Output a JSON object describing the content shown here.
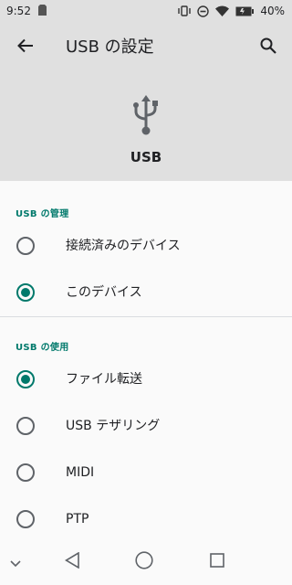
{
  "status": {
    "time": "9:52",
    "battery": "40%"
  },
  "toolbar": {
    "title": "USB の設定"
  },
  "hero": {
    "label": "USB"
  },
  "sections": {
    "management": {
      "header": "USB の管理",
      "options": [
        {
          "label": "接続済みのデバイス",
          "checked": false
        },
        {
          "label": "このデバイス",
          "checked": true
        }
      ]
    },
    "usage": {
      "header": "USB の使用",
      "options": [
        {
          "label": "ファイル転送",
          "checked": true
        },
        {
          "label": "USB テザリング",
          "checked": false
        },
        {
          "label": "MIDI",
          "checked": false
        },
        {
          "label": "PTP",
          "checked": false
        }
      ]
    }
  },
  "colors": {
    "accent": "#00796b",
    "header_bg": "#e0e0e0",
    "page_bg": "#fafafa"
  },
  "icons": [
    "sim-icon",
    "vibrate-icon",
    "dnd-icon",
    "wifi-icon",
    "battery-icon",
    "back-arrow-icon",
    "search-icon",
    "usb-icon",
    "chevron-down-icon",
    "nav-back-icon",
    "nav-home-icon",
    "nav-recents-icon"
  ]
}
